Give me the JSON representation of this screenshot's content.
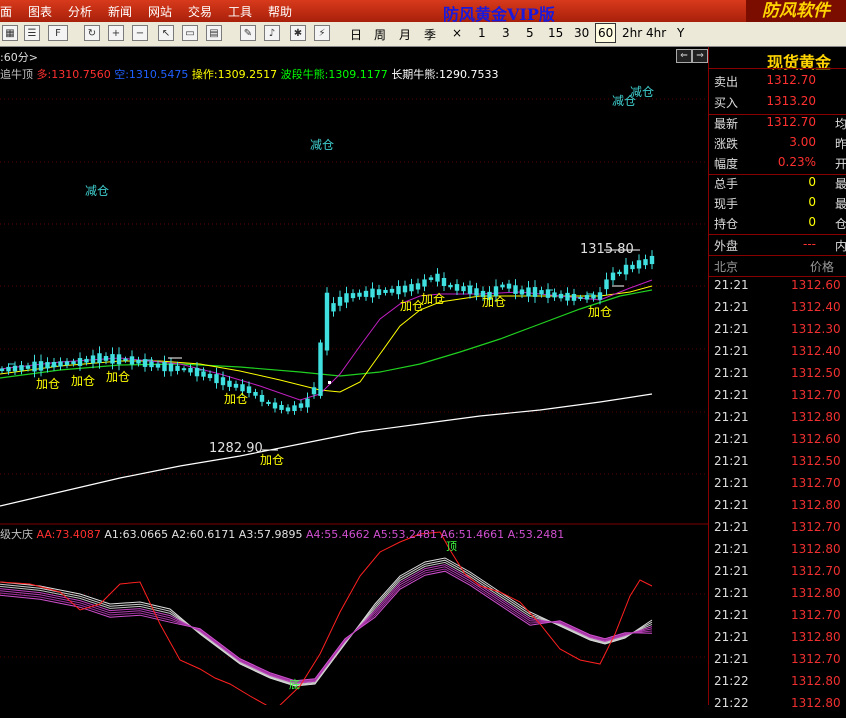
{
  "menu": {
    "items": [
      "面",
      "图表",
      "分析",
      "新闻",
      "网站",
      "交易",
      "工具",
      "帮助"
    ],
    "center_brand": "防风黄金VIP版",
    "right_brand": "防风软件"
  },
  "toolbar": {
    "periods": [
      "日",
      "周",
      "月",
      "季",
      "×",
      "1",
      "3",
      "5",
      "15",
      "30",
      "60",
      "2hr",
      "4hr",
      "Y"
    ],
    "active_period": "60"
  },
  "chart_header": {
    "period_label": ":60分>",
    "legend": [
      {
        "text": "追牛顶",
        "color": "#c0c0c0"
      },
      {
        "text": "多:1310.7560",
        "color": "#ff3030"
      },
      {
        "text": "空:1310.5475",
        "color": "#2060ff"
      },
      {
        "text": "操作:1309.2517",
        "color": "#ffff00"
      },
      {
        "text": "波段牛熊:1309.1177",
        "color": "#00ff00"
      },
      {
        "text": "长期牛熊:1290.7533",
        "color": "#ffffff"
      }
    ]
  },
  "indicator_header": {
    "legend": [
      {
        "text": "级大庆",
        "color": "#c0c0c0"
      },
      {
        "text": "AA:73.4087",
        "color": "#ff3030"
      },
      {
        "text": "A1:63.0665",
        "color": "#e0e0e0"
      },
      {
        "text": "A2:60.6171",
        "color": "#e0e0e0"
      },
      {
        "text": "A3:57.9895",
        "color": "#e0e0e0"
      },
      {
        "text": "A4:55.4662",
        "color": "#d050d0"
      },
      {
        "text": "A5:53.2481",
        "color": "#d050d0"
      },
      {
        "text": "A6:51.4661",
        "color": "#d050d0"
      },
      {
        "text": "A:53.2481",
        "color": "#d050d0"
      }
    ]
  },
  "annotations": {
    "high_label": "1315.80",
    "low_label": "1282.90",
    "signals": [
      {
        "text": "减仓",
        "color": "#40d0d0"
      },
      {
        "text": "减仓",
        "color": "#40d0d0"
      },
      {
        "text": "减仓",
        "color": "#40d0d0"
      },
      {
        "text": "减仓",
        "color": "#40d0d0"
      },
      {
        "text": "加仓",
        "color": "#ffff00"
      },
      {
        "text": "加仓",
        "color": "#ffff00"
      },
      {
        "text": "加仓",
        "color": "#ffff00"
      },
      {
        "text": "加仓",
        "color": "#ffff00"
      },
      {
        "text": "加仓",
        "color": "#ffff00"
      },
      {
        "text": "加仓",
        "color": "#ffff00"
      },
      {
        "text": "加仓",
        "color": "#ffff00"
      },
      {
        "text": "加仓",
        "color": "#ffff00"
      },
      {
        "text": "加仓",
        "color": "#ffff00"
      }
    ],
    "top_mark": "顶",
    "bottom_mark": "底"
  },
  "quote": {
    "title": "现货黄金",
    "rows1": [
      {
        "label": "卖出",
        "value": "1312.70",
        "color": "#ff3030",
        "extra": ""
      },
      {
        "label": "买入",
        "value": "1313.20",
        "color": "#ff3030",
        "extra": ""
      }
    ],
    "rows2": [
      {
        "label": "最新",
        "value": "1312.70",
        "color": "#ff3030",
        "extra": "均"
      },
      {
        "label": "涨跌",
        "value": "3.00",
        "color": "#ff3030",
        "extra": "昨"
      },
      {
        "label": "幅度",
        "value": "0.23%",
        "color": "#ff3030",
        "extra": "开"
      }
    ],
    "rows3": [
      {
        "label": "总手",
        "value": "0",
        "color": "#ffff00",
        "extra": "最"
      },
      {
        "label": "现手",
        "value": "0",
        "color": "#ffff00",
        "extra": "最"
      },
      {
        "label": "持仓",
        "value": "0",
        "color": "#ffff00",
        "extra": "仓"
      }
    ],
    "outer": {
      "label": "外盘",
      "value": "---",
      "color": "#ff3030",
      "extra": "内"
    },
    "tick_header": {
      "time": "北京",
      "price": "价格"
    },
    "ticks": [
      {
        "time": "21:21",
        "price": "1312.60"
      },
      {
        "time": "21:21",
        "price": "1312.40"
      },
      {
        "time": "21:21",
        "price": "1312.30"
      },
      {
        "time": "21:21",
        "price": "1312.40"
      },
      {
        "time": "21:21",
        "price": "1312.50"
      },
      {
        "time": "21:21",
        "price": "1312.70"
      },
      {
        "time": "21:21",
        "price": "1312.80"
      },
      {
        "time": "21:21",
        "price": "1312.60"
      },
      {
        "time": "21:21",
        "price": "1312.50"
      },
      {
        "time": "21:21",
        "price": "1312.70"
      },
      {
        "time": "21:21",
        "price": "1312.80"
      },
      {
        "time": "21:21",
        "price": "1312.70"
      },
      {
        "time": "21:21",
        "price": "1312.80"
      },
      {
        "time": "21:21",
        "price": "1312.70"
      },
      {
        "time": "21:21",
        "price": "1312.80"
      },
      {
        "time": "21:21",
        "price": "1312.70"
      },
      {
        "time": "21:21",
        "price": "1312.80"
      },
      {
        "time": "21:21",
        "price": "1312.70"
      },
      {
        "time": "21:22",
        "price": "1312.80"
      },
      {
        "time": "21:22",
        "price": "1312.80"
      }
    ]
  },
  "colors": {
    "menu_bg": "#c0300f",
    "candle_up": "#40e0e0",
    "ma_purple": "#c020c0",
    "ma_yellow": "#ffff00",
    "ma_green": "#20d020",
    "long_line": "#ffffff",
    "grid": "#5a0000"
  }
}
